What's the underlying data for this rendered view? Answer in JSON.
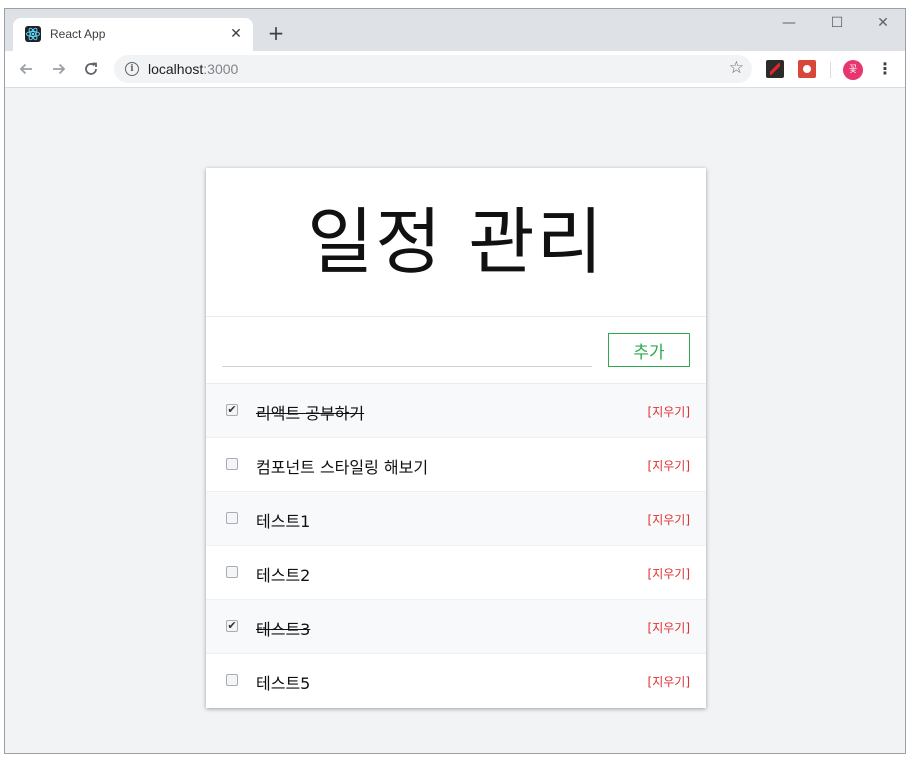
{
  "browser": {
    "tab_title": "React App",
    "tab_close": "✕",
    "new_tab": "+",
    "url_host": "localhost",
    "url_port": ":3000",
    "avatar_initial": "꽃",
    "minimize": "—",
    "maximize": "☐",
    "close": "✕"
  },
  "colors": {
    "page_bg": "#f1f3f5",
    "add_button": "#2fa84f",
    "remove_link": "#e03131"
  },
  "app": {
    "title": "일정 관리",
    "input_value": "",
    "add_label": "추가",
    "remove_label": "[지우기]",
    "todos": [
      {
        "text": "리액트 공부하기",
        "done": true
      },
      {
        "text": "컴포넌트 스타일링 해보기",
        "done": false
      },
      {
        "text": "테스트1",
        "done": false
      },
      {
        "text": "테스트2",
        "done": false
      },
      {
        "text": "테스트3",
        "done": true
      },
      {
        "text": "테스트5",
        "done": false
      }
    ]
  }
}
